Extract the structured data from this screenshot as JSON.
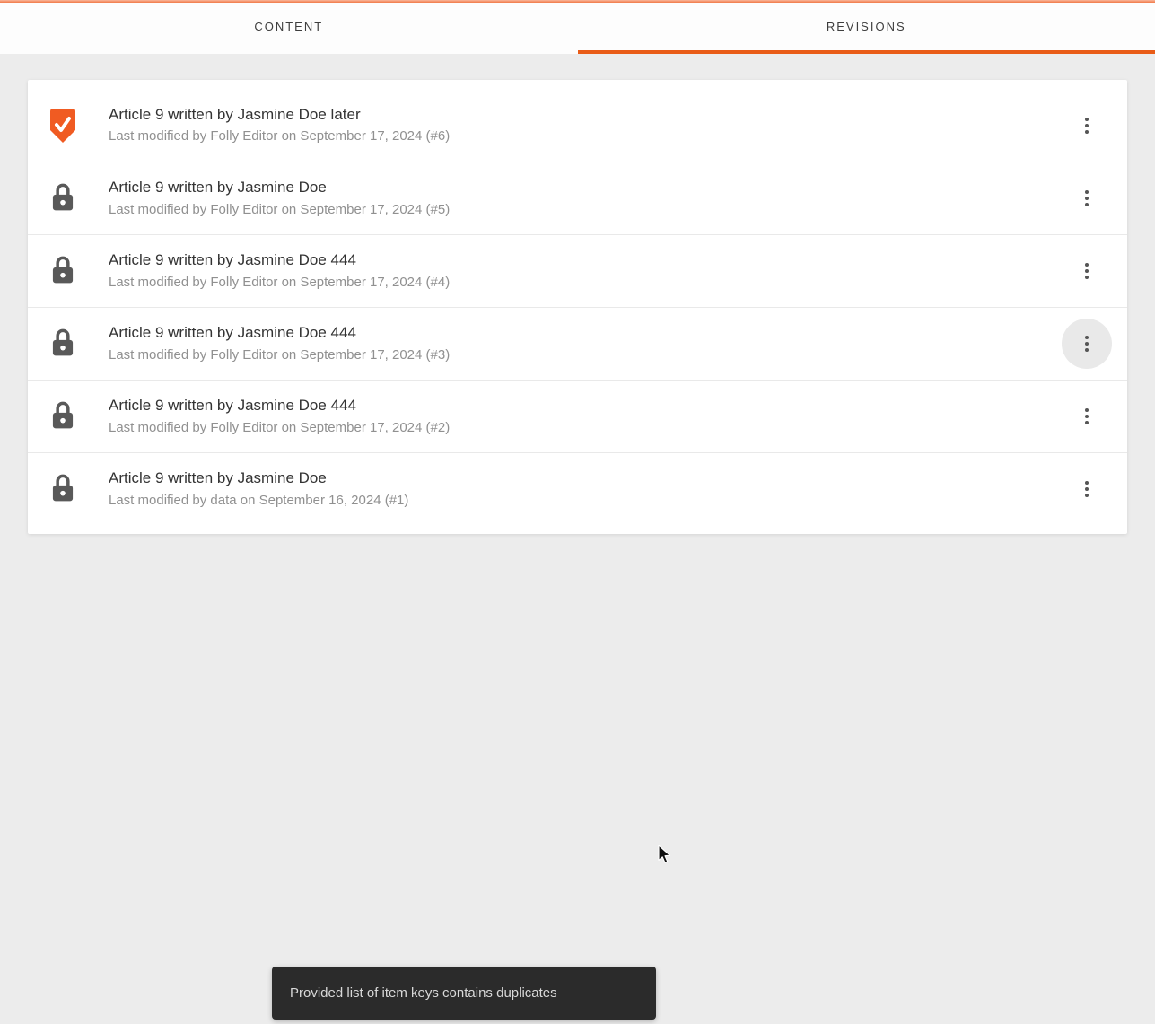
{
  "header": {
    "tabs": [
      {
        "label": "CONTENT",
        "active": false
      },
      {
        "label": "REVISIONS",
        "active": true
      }
    ]
  },
  "revisions": [
    {
      "icon": "current-version-badge-check-icon",
      "title": "Article 9 written by Jasmine Doe later",
      "meta": "Last modified by Folly Editor on September 17, 2024 (#6)",
      "menu_hovered": false
    },
    {
      "icon": "lock-icon",
      "title": "Article 9 written by Jasmine Doe",
      "meta": "Last modified by Folly Editor on September 17, 2024 (#5)",
      "menu_hovered": false
    },
    {
      "icon": "lock-icon",
      "title": "Article 9 written by Jasmine Doe 444",
      "meta": "Last modified by Folly Editor on September 17, 2024 (#4)",
      "menu_hovered": false
    },
    {
      "icon": "lock-icon",
      "title": "Article 9 written by Jasmine Doe 444",
      "meta": "Last modified by Folly Editor on September 17, 2024 (#3)",
      "menu_hovered": true
    },
    {
      "icon": "lock-icon",
      "title": "Article 9 written by Jasmine Doe 444",
      "meta": "Last modified by Folly Editor on September 17, 2024 (#2)",
      "menu_hovered": false
    },
    {
      "icon": "lock-icon",
      "title": "Article 9 written by Jasmine Doe",
      "meta": "Last modified by data on September 16, 2024 (#1)",
      "menu_hovered": false
    }
  ],
  "toast": {
    "message": "Provided list of item keys contains duplicates"
  },
  "colors": {
    "accent_orange": "#e95c17",
    "top_line_orange": "#f59a77",
    "icon_gray": "#595959",
    "toast_background": "#2b2b2b",
    "page_background": "#ececec"
  }
}
